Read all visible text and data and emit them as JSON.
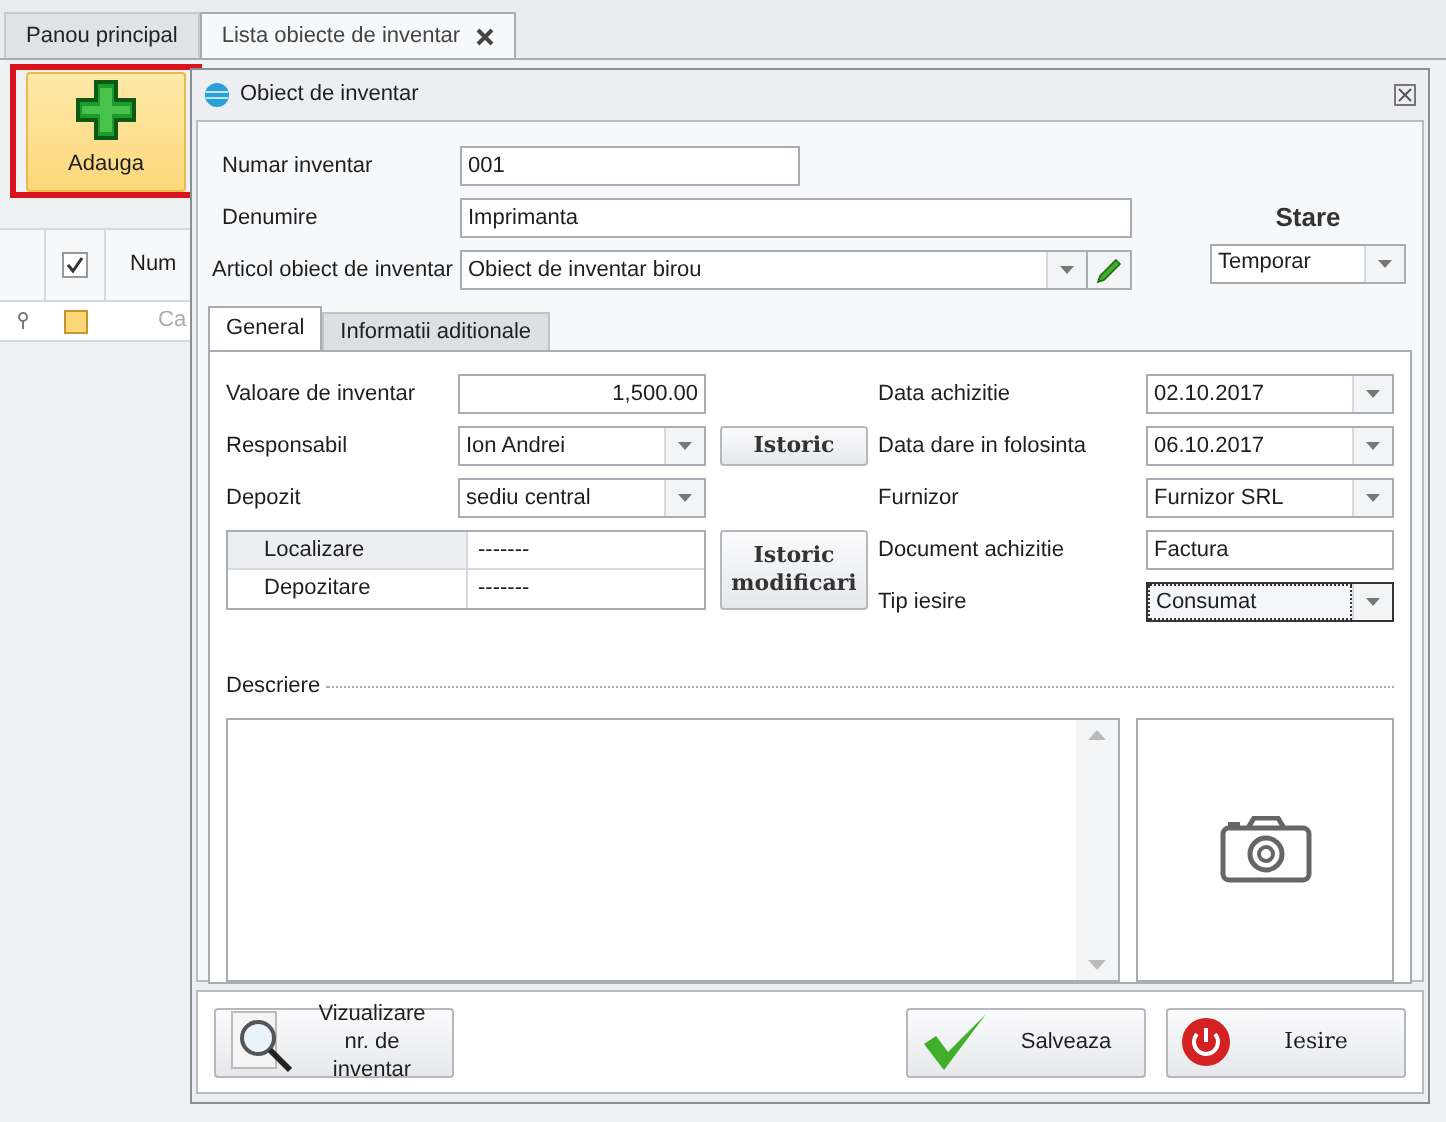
{
  "tabs": [
    {
      "label": "Panou principal",
      "selected": false
    },
    {
      "label": "Lista obiecte de inventar",
      "selected": true
    }
  ],
  "toolbar": {
    "add_button": "Adauga",
    "highlighted": true
  },
  "grid": {
    "header_checked": true,
    "row_selected": true,
    "column_header": "Num",
    "cell": "Ca"
  },
  "dialog": {
    "title": "Obiect de inventar",
    "numar_inventar": {
      "label": "Numar inventar",
      "value": "001"
    },
    "denumire": {
      "label": "Denumire",
      "value": "Imprimanta"
    },
    "articol": {
      "label": "Articol obiect de inventar",
      "value": "Obiect de inventar birou"
    },
    "stare": {
      "label": "Stare",
      "value": "Temporar"
    },
    "tabs": [
      {
        "label": "General",
        "selected": true
      },
      {
        "label": "Informatii aditionale",
        "selected": false
      }
    ],
    "left_fields": [
      {
        "kind": "number",
        "label": "Valoare de inventar",
        "value": "1,500.00"
      },
      {
        "kind": "combo",
        "label": "Responsabil",
        "value": "Ion Andrei"
      },
      {
        "kind": "combo",
        "label": "Depozit",
        "value": "sediu central"
      }
    ],
    "istoric_button": "Istoric",
    "location_grid": [
      {
        "label": "Localizare",
        "value": "-------"
      },
      {
        "label": "Depozitare",
        "value": "-------"
      }
    ],
    "istoric_modificari_button": "Istoric modificari",
    "right_fields": [
      {
        "kind": "combo",
        "label": "Data achizitie",
        "value": "02.10.2017",
        "focused": false
      },
      {
        "kind": "combo",
        "label": "Data dare in folosinta",
        "value": "06.10.2017",
        "focused": false
      },
      {
        "kind": "combo",
        "label": "Furnizor",
        "value": "Furnizor SRL",
        "focused": false
      },
      {
        "kind": "text",
        "label": "Document achizitie",
        "value": "Factura",
        "focused": false
      },
      {
        "kind": "combo",
        "label": "Tip iesire",
        "value": "Consumat",
        "focused": true
      }
    ],
    "descriere_label": "Descriere",
    "buttons": [
      {
        "kind": "view",
        "label": "Vizualizare nr. de inventar"
      },
      {
        "kind": "save",
        "label": "Salveaza"
      },
      {
        "kind": "exit",
        "label": "Iesire"
      }
    ]
  }
}
